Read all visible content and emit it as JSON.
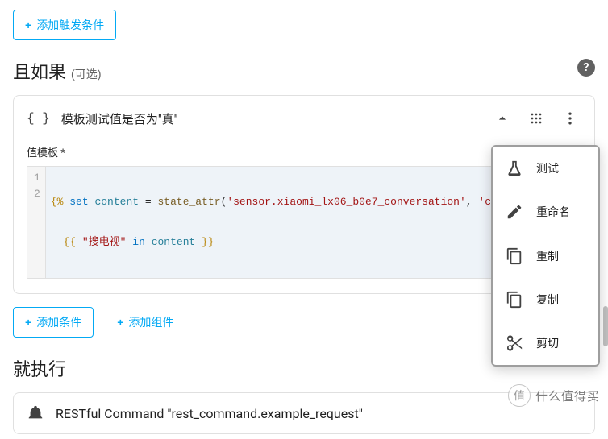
{
  "buttons": {
    "add_trigger_condition": "添加触发条件",
    "add_condition": "添加条件",
    "add_component": "添加组件"
  },
  "sections": {
    "and_if": "且如果",
    "optional": "(可选)",
    "then_execute": "就执行"
  },
  "condition_card": {
    "title": "模板测试值是否为\"真\"",
    "value_template_label": "值模板 *",
    "code": {
      "line1_a": "{%",
      "line1_b": "set",
      "line1_c": "content",
      "line1_d": "=",
      "line1_e": "state_attr",
      "line1_f": "(",
      "line1_g": "'sensor.xiaomi_lx06_b0e7_conversation'",
      "line1_h": ", ",
      "line1_i": "'content'",
      "line1_j": ")",
      "line2_a": "{{",
      "line2_b": "\"搜电视\"",
      "line2_c": "in",
      "line2_d": "content",
      "line2_e": "}}"
    },
    "gutter": {
      "l1": "1",
      "l2": "2"
    }
  },
  "action_card": {
    "title": "RESTful Command \"rest_command.example_request\""
  },
  "dropdown": {
    "test": "测试",
    "rename": "重命名",
    "duplicate": "重制",
    "copy": "复制",
    "cut": "剪切"
  },
  "watermark": {
    "badge": "值",
    "text": "什么值得买"
  }
}
